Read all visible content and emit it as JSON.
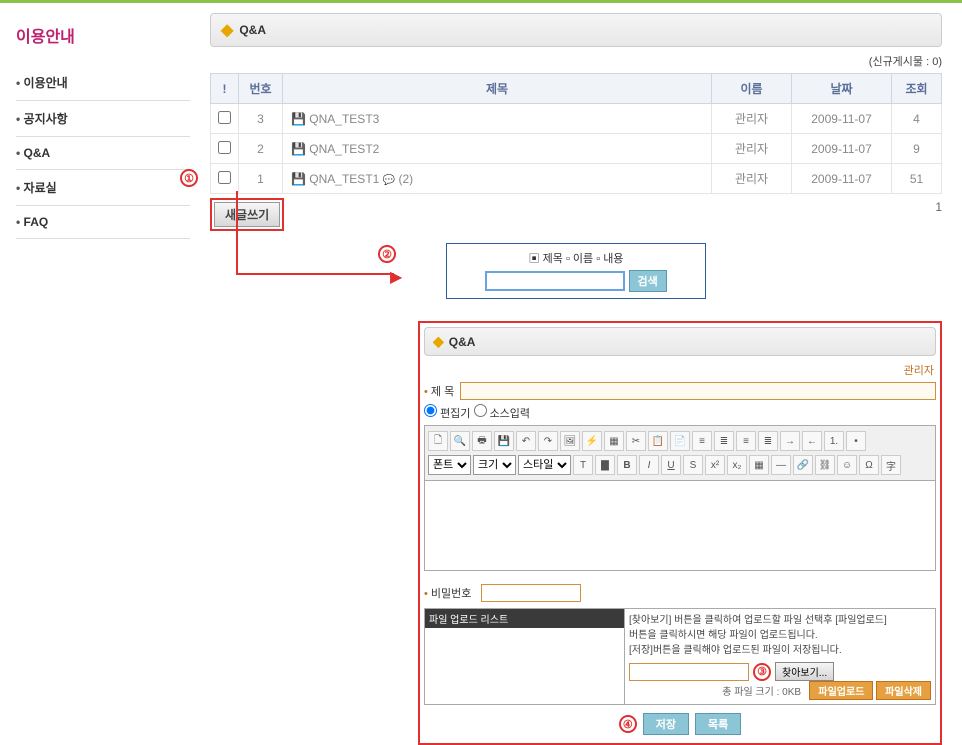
{
  "sidebar": {
    "title": "이용안내",
    "items": [
      "이용안내",
      "공지사항",
      "Q&A",
      "자료실",
      "FAQ"
    ]
  },
  "panel": {
    "title": "Q&A",
    "new_post_label": "(신규게시물 : 0)"
  },
  "table": {
    "headers": {
      "check": "!",
      "no": "번호",
      "title": "제목",
      "name": "이름",
      "date": "날짜",
      "views": "조회"
    },
    "rows": [
      {
        "no": "3",
        "title": "QNA_TEST3",
        "comment": "",
        "name": "관리자",
        "date": "2009-11-07",
        "views": "4"
      },
      {
        "no": "2",
        "title": "QNA_TEST2",
        "comment": "",
        "name": "관리자",
        "date": "2009-11-07",
        "views": "9"
      },
      {
        "no": "1",
        "title": "QNA_TEST1",
        "comment": "(2)",
        "name": "관리자",
        "date": "2009-11-07",
        "views": "51"
      }
    ]
  },
  "write_btn": "새글쓰기",
  "page": "1",
  "search": {
    "opt_title": "제목",
    "opt_name": "이름",
    "opt_content": "내용",
    "btn": "검색"
  },
  "steps": {
    "s1": "①",
    "s2": "②",
    "s3": "③",
    "s4": "④"
  },
  "editor": {
    "panel_title": "Q&A",
    "author": "관리자",
    "title_label": "제 목",
    "radio1": "편집기",
    "radio2": "소스입력",
    "sel_font": "폰트",
    "sel_size": "크기",
    "sel_style": "스타일",
    "pw_label": "비밀번호",
    "upload": {
      "list_header": "파일 업로드 리스트",
      "help1": "[찾아보기] 버튼을 클릭하여 업로드할 파일 선택후 [파일업로드]",
      "help2": "버튼을 클릭하시면 해당 파일이 업로드됩니다.",
      "help3": "[저장]버튼을 클릭해야 업로드된 파일이 저장됩니다.",
      "browse": "찾아보기...",
      "size_info": "총 파일 크기 : 0KB",
      "btn_upload": "파일업로드",
      "btn_delete": "파일삭제"
    },
    "btn_save": "저장",
    "btn_list": "목록"
  }
}
